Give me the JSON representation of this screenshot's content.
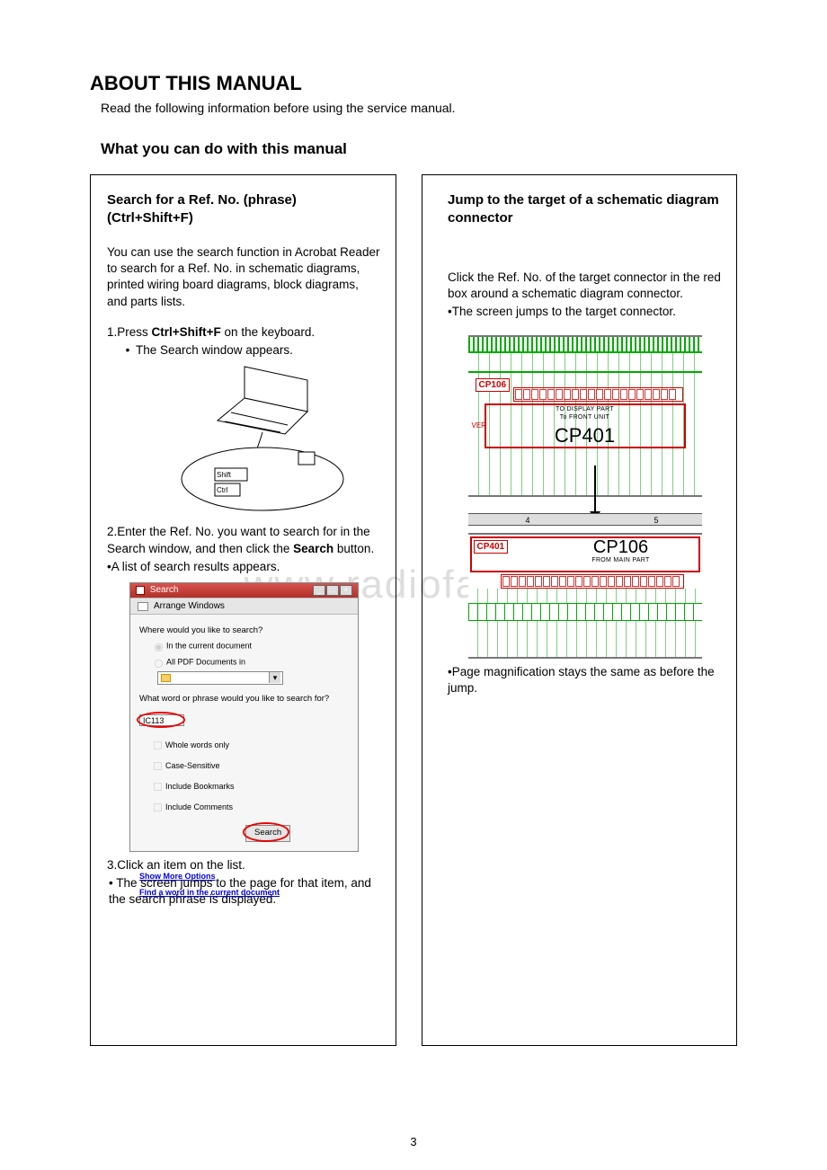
{
  "heading": "ABOUT THIS MANUAL",
  "intro": "Read the following information before using the service manual.",
  "subheading": "What you can do with this manual",
  "watermark": "www.radiofans.cn",
  "page_number": "3",
  "left": {
    "title": "Search for a Ref. No. (phrase) (Ctrl+Shift+F)",
    "desc": "You can use the search function in Acrobat Reader to search for a Ref. No. in schematic diagrams, printed wiring board diagrams, block diagrams, and parts lists.",
    "step1_prefix": "1.Press ",
    "step1_bold": "Ctrl+Shift+F",
    "step1_suffix": " on the keyboard.",
    "step1_result": "The Search window appears.",
    "laptop_keys": {
      "shift": "Shift",
      "ctrl": "Ctrl"
    },
    "step2_a": "2.Enter the Ref. No. you want to search for in the Search window, and then click the ",
    "step2_bold": "Search",
    "step2_b": " button.",
    "step2_result": "•A list of search results appears.",
    "dialog": {
      "title": "Search",
      "arrange": "Arrange Windows",
      "where": "Where would you like to search?",
      "opt_current": "In the current document",
      "opt_all": "All PDF Documents in",
      "what": "What word or phrase would you like to search for?",
      "input_value": "IC113",
      "check_whole": "Whole words only",
      "check_case": "Case-Sensitive",
      "check_bookmarks": "Include Bookmarks",
      "check_comments": "Include Comments",
      "search_btn": "Search",
      "link_more": "Show More Options",
      "link_find": "Find a word in the current document"
    },
    "step3": "3.Click an item on the list.",
    "step3_result": "• The screen jumps to the page for that item, and the search phrase is displayed."
  },
  "right": {
    "title": "Jump to the target of a schematic diagram connector",
    "desc1": "Click the Ref. No. of the target connector in the red box around a schematic diagram connector.",
    "desc2": "•The screen jumps to the target connector.",
    "schematic": {
      "cp106": "CP106",
      "cp401": "CP401",
      "ver": "VER",
      "to_display": "TO DISPLAY PART",
      "to_front": "To FRONT UNIT",
      "from_main": "FROM MAIN PART",
      "ruler_4": "4",
      "ruler_5": "5"
    },
    "note": "•Page magnification stays the same as before the jump."
  }
}
